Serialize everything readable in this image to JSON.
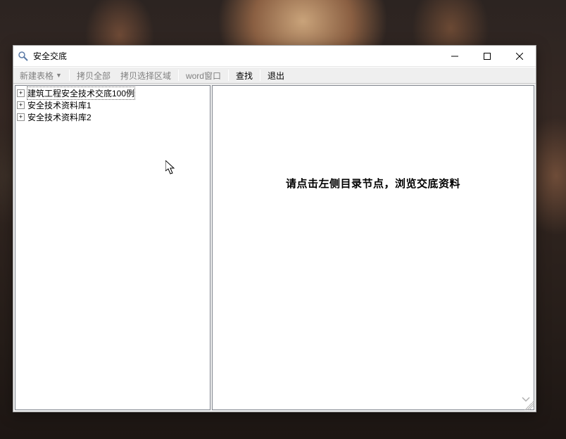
{
  "window": {
    "title": "安全交底"
  },
  "toolbar": {
    "new_table": "新建表格",
    "copy_all": "拷贝全部",
    "copy_selection": "拷贝选择区域",
    "word_window": "word窗口",
    "find": "查找",
    "exit": "退出"
  },
  "tree": {
    "items": [
      {
        "label": "建筑工程安全技术交底100例",
        "selected": true
      },
      {
        "label": "安全技术资料库1",
        "selected": false
      },
      {
        "label": "安全技术资料库2",
        "selected": false
      }
    ]
  },
  "content": {
    "empty_message": "请点击左侧目录节点，浏览交底资料"
  }
}
